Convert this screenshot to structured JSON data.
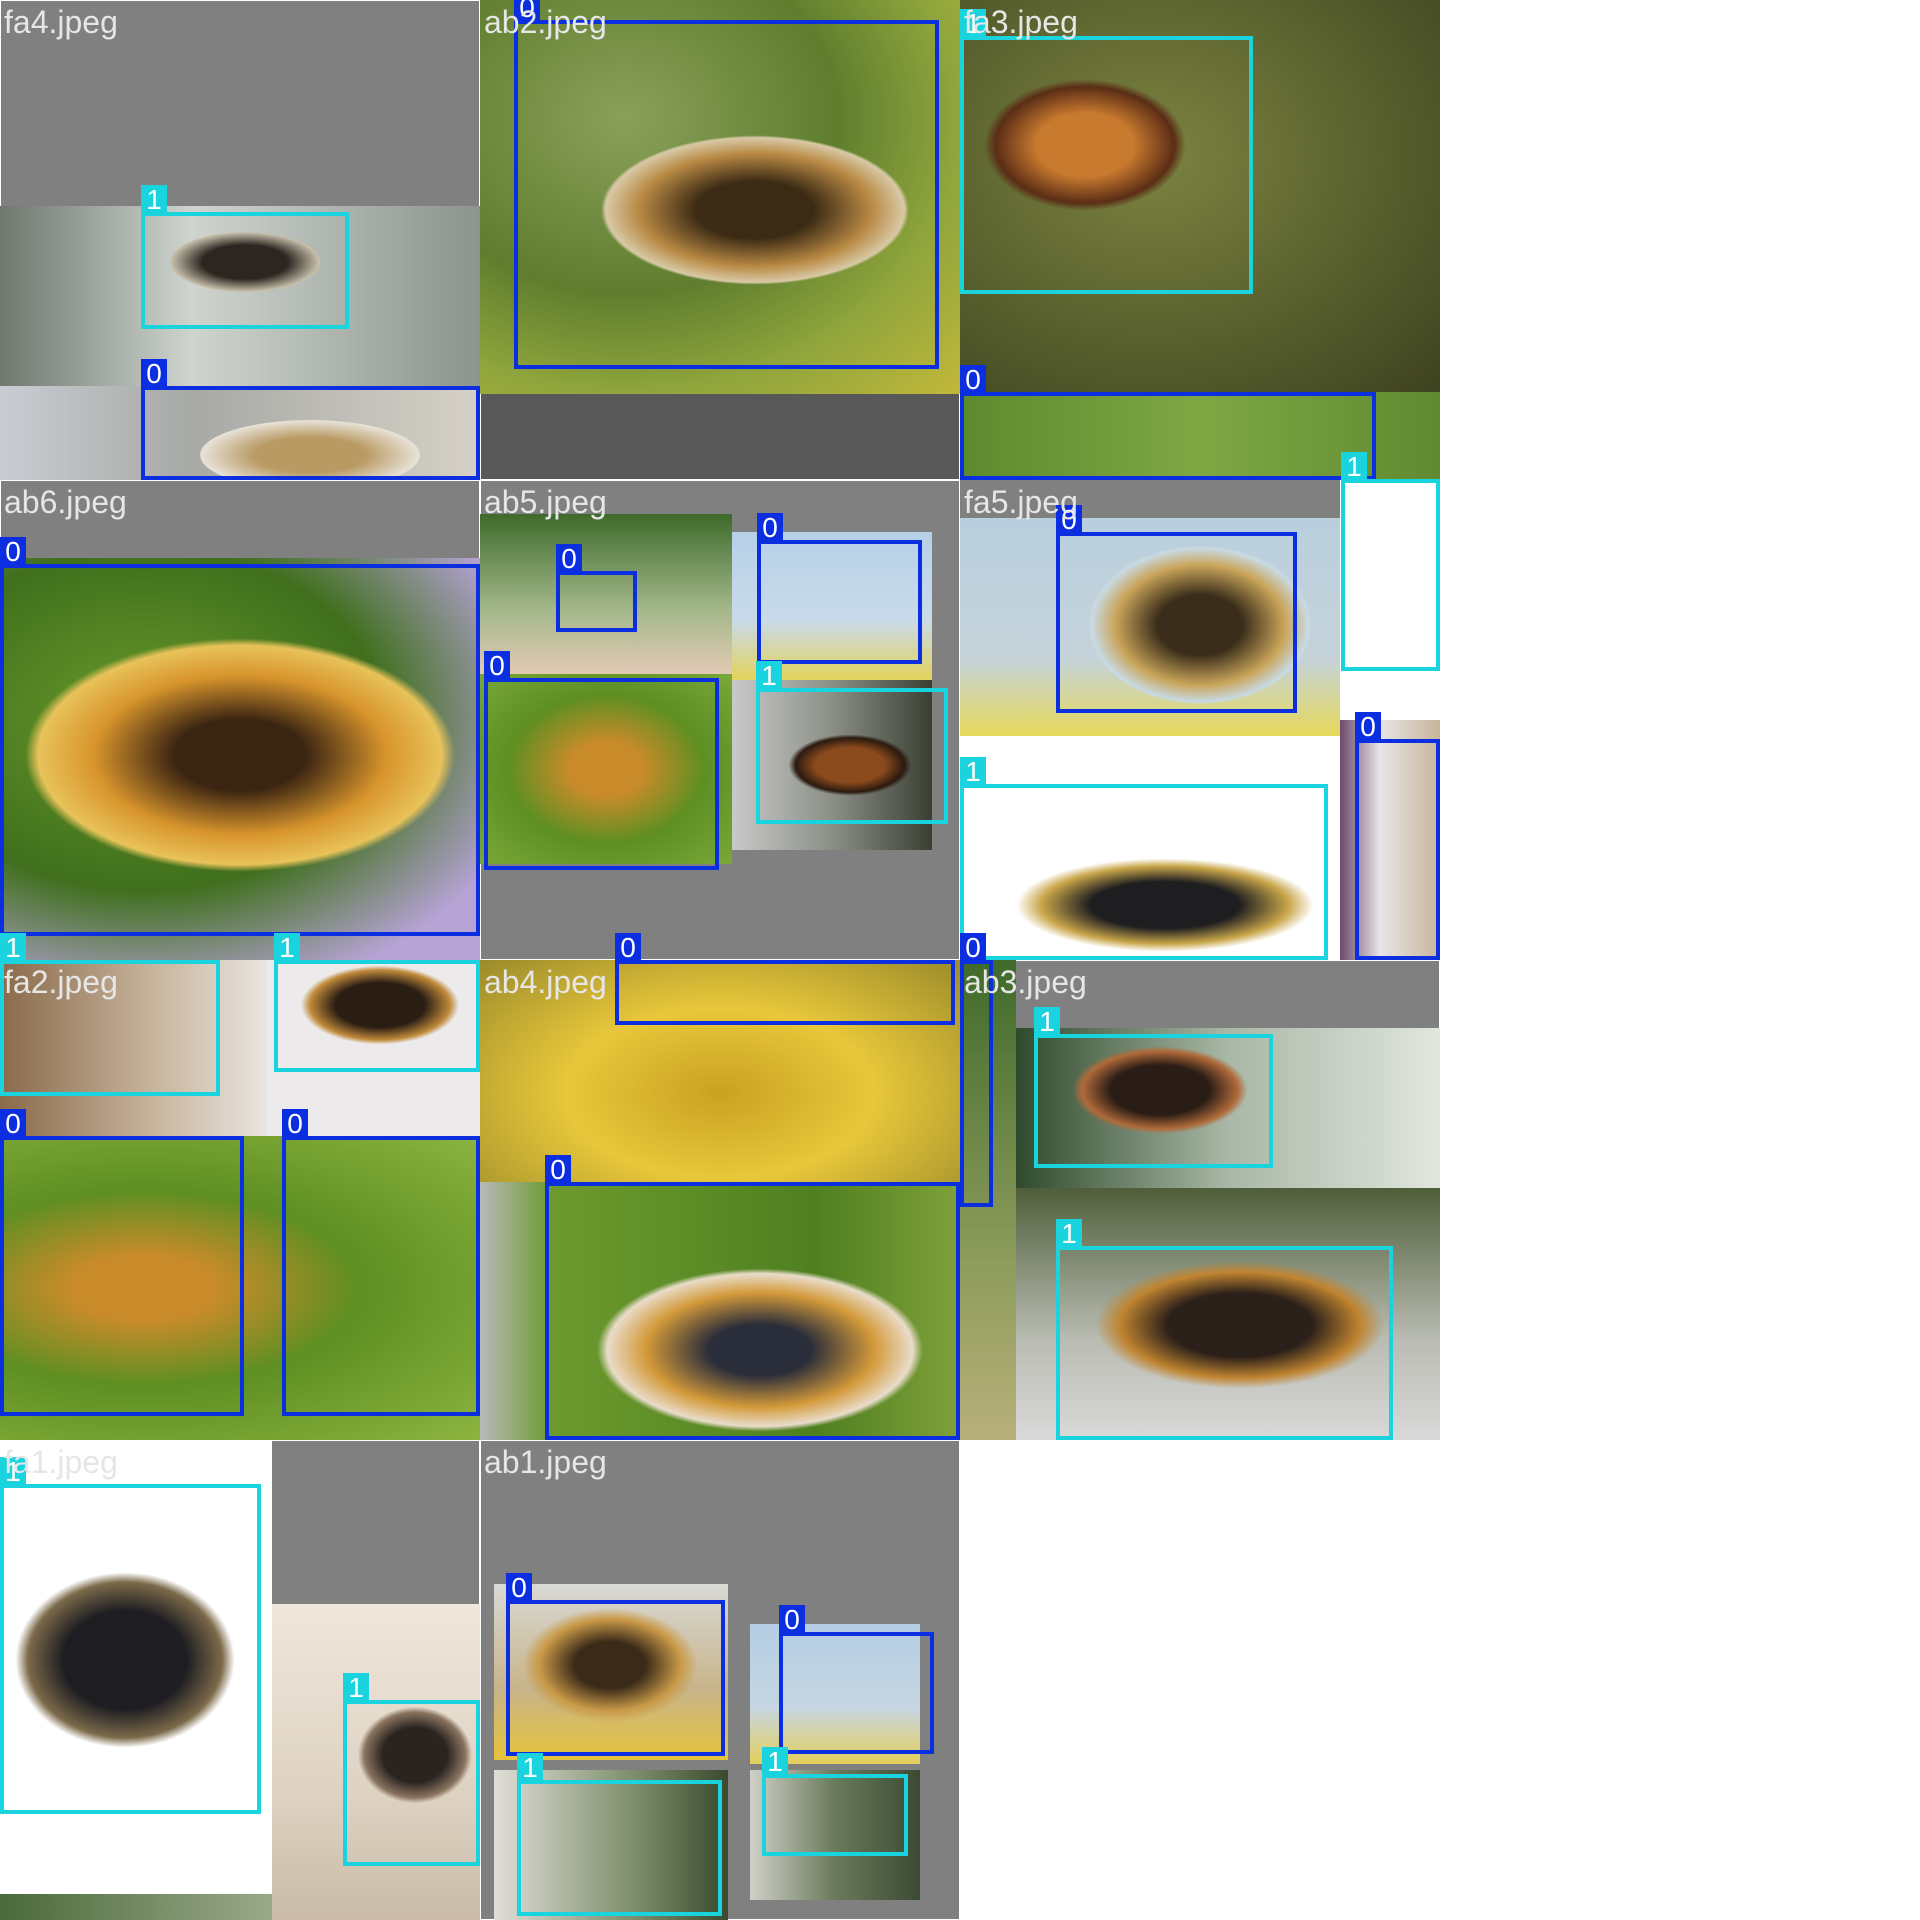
{
  "colors": {
    "class_0": "#0a2ee0",
    "class_1": "#19d3de",
    "padding_gray": "#808080"
  },
  "tiles": [
    {
      "title": "fa4.jpeg",
      "boxes": [
        {
          "cls": "1"
        },
        {
          "cls": "0"
        }
      ]
    },
    {
      "title": "ab2.jpeg",
      "boxes": [
        {
          "cls": "0"
        }
      ]
    },
    {
      "title": "fa3.jpeg",
      "boxes": [
        {
          "cls": "1"
        },
        {
          "cls": "0"
        }
      ]
    },
    {
      "title": "ab6.jpeg",
      "boxes": [
        {
          "cls": "0"
        },
        {
          "cls": "1"
        },
        {
          "cls": "1"
        }
      ]
    },
    {
      "title": "ab5.jpeg",
      "boxes": [
        {
          "cls": "0"
        },
        {
          "cls": "0"
        },
        {
          "cls": "0"
        },
        {
          "cls": "1"
        }
      ]
    },
    {
      "title": "fa5.jpeg",
      "boxes": [
        {
          "cls": "0"
        },
        {
          "cls": "1"
        },
        {
          "cls": "1"
        },
        {
          "cls": "0"
        }
      ]
    },
    {
      "title": "fa2.jpeg",
      "boxes": [
        {
          "cls": "0"
        },
        {
          "cls": "0"
        }
      ]
    },
    {
      "title": "ab4.jpeg",
      "boxes": [
        {
          "cls": "0"
        },
        {
          "cls": "0"
        }
      ]
    },
    {
      "title": "ab3.jpeg",
      "boxes": [
        {
          "cls": "0"
        },
        {
          "cls": "1"
        },
        {
          "cls": "1"
        }
      ]
    },
    {
      "title": "fa1.jpeg",
      "boxes": [
        {
          "cls": "1"
        },
        {
          "cls": "1"
        }
      ]
    },
    {
      "title": "ab1.jpeg",
      "boxes": [
        {
          "cls": "0"
        },
        {
          "cls": "0"
        },
        {
          "cls": "1"
        },
        {
          "cls": "1"
        }
      ]
    }
  ]
}
